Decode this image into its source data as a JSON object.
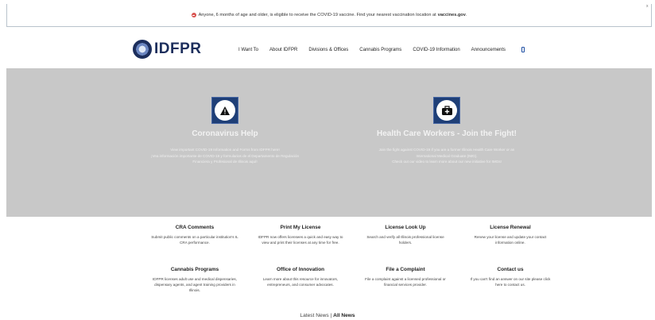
{
  "alert": {
    "text": "Anyone, 6 months of age and older, is eligible to receive the COVID-19 vaccine. Find your nearest vaccination location at",
    "link": "vaccines.gov",
    "close": "x"
  },
  "brand": {
    "name": "IDFPR"
  },
  "nav": [
    "I Want To",
    "About IDFPR",
    "Divisions & Offices",
    "Cannabis Programs",
    "COVID-19 Information",
    "Announcements"
  ],
  "hero": {
    "left": {
      "title": "Coronavirus Help",
      "desc": "View important COVID-19 Information and Forms from IDFPR here!\n¡Vea información importante de COVID-19 y formularios de el Departamento de Regulación\nFinanciera y Profesional de Illinois aquí!"
    },
    "right": {
      "title": "Health Care Workers - Join the Fight!",
      "desc": "Join the fight against COVID-19 if you are a former Illinois Health Care Worker or an\nInternational Medical Graduate (IMG).\nCheck out our video to learn more about our new initiative for IMGs!"
    }
  },
  "services": [
    {
      "title": "CRA Comments",
      "desc": "Submit public comments on a particular institution's IL CRA performance."
    },
    {
      "title": "Print My License",
      "desc": "IDFPR now offers licensees a quick and easy way to view and print their licenses at any time for free."
    },
    {
      "title": "License Look Up",
      "desc": "Search and verify all Illinois professional license holders."
    },
    {
      "title": "License Renewal",
      "desc": "Renew your license and update your contact information online."
    },
    {
      "title": "Cannabis Programs",
      "desc": "IDFPR licenses adult use and medical dispensaries, dispensary agents, and agent training providers in Illinois."
    },
    {
      "title": "Office of Innovation",
      "desc": "Learn more about this resource for innovators, entrepreneurs, and consumer advocates."
    },
    {
      "title": "File a Complaint",
      "desc": "File a complaint against a licensed professional or financial services provider."
    },
    {
      "title": "Contact us",
      "desc": "If you can't find an answer on our site please click here to contact us."
    }
  ],
  "latest": {
    "prefix": "Latest News | ",
    "link": "All News"
  }
}
